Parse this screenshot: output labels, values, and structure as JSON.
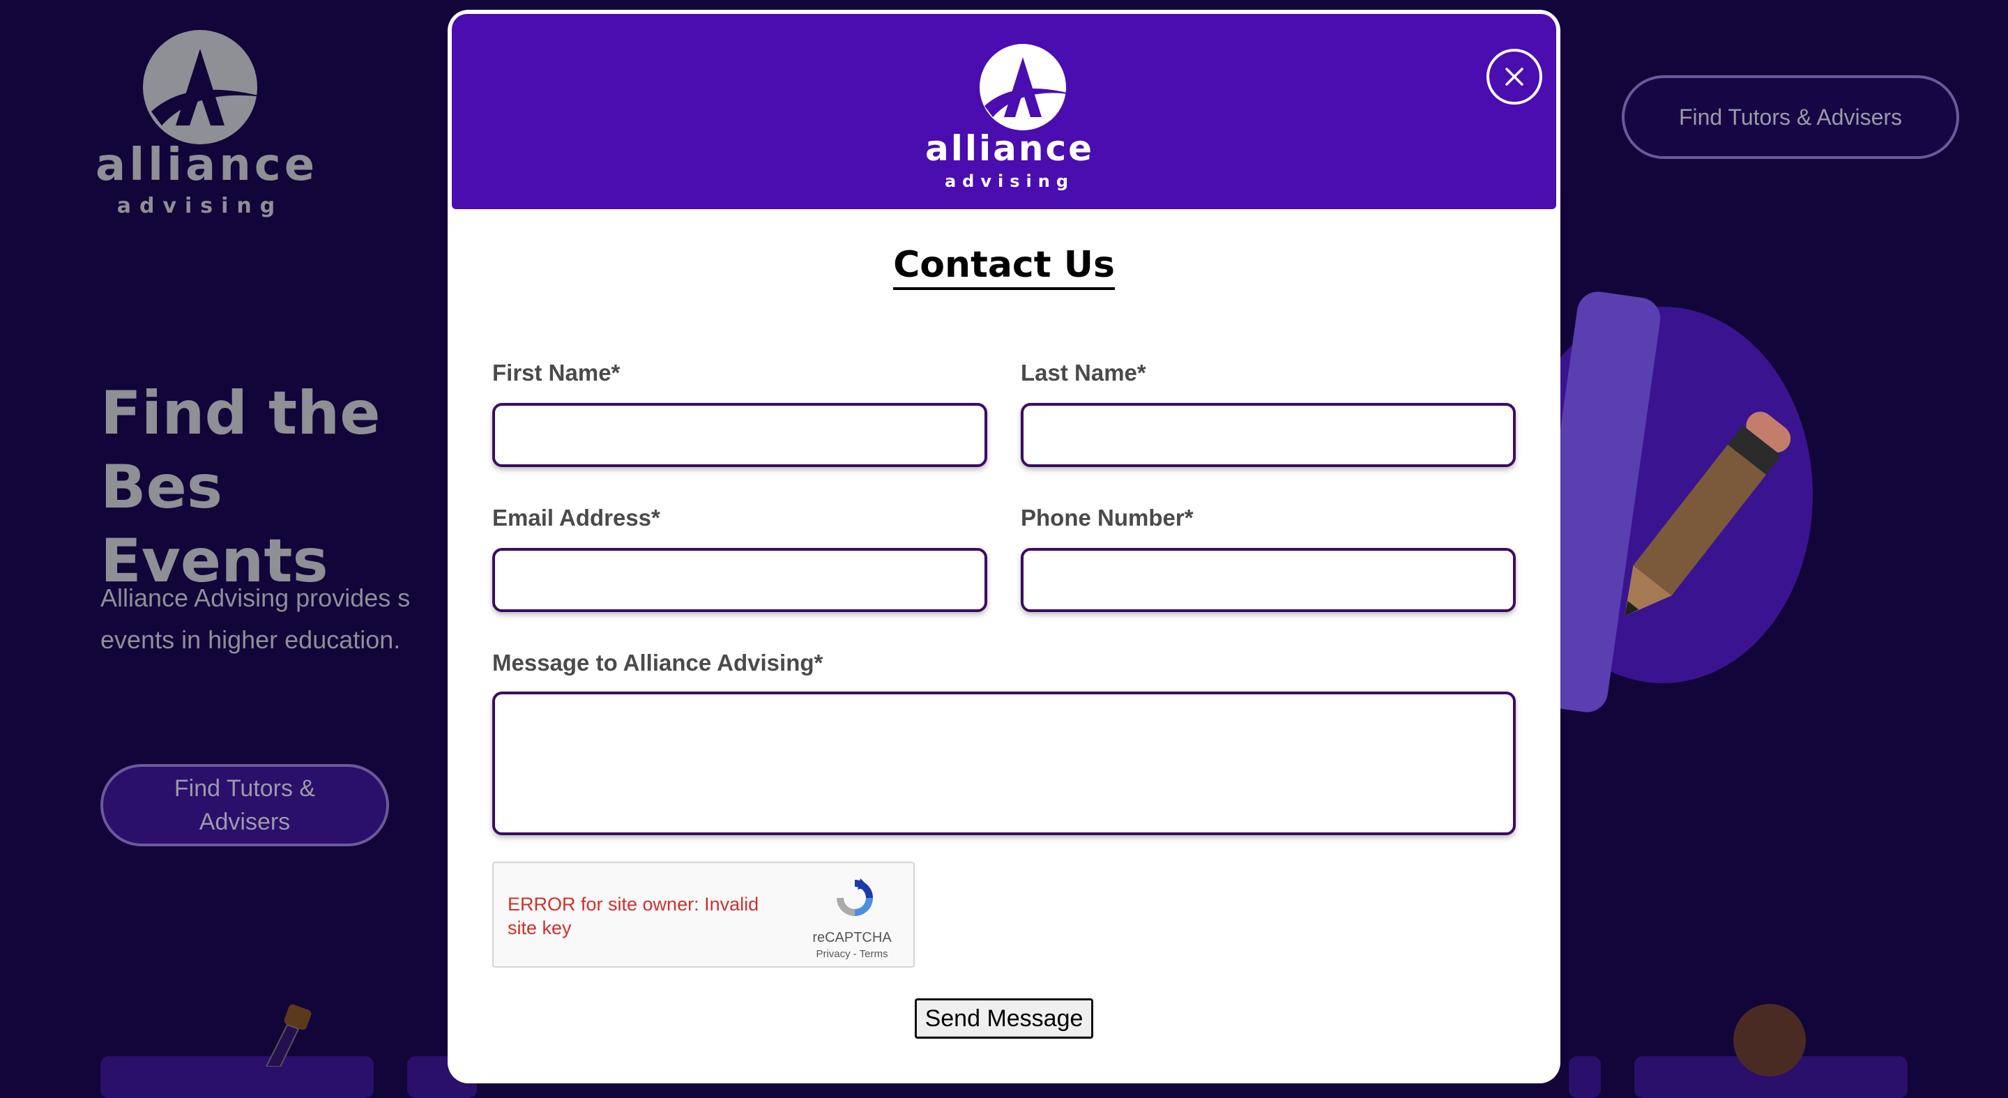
{
  "background": {
    "logo": {
      "word": "alliance",
      "sub": "advising"
    },
    "nav_button_label": "Find Tutors & Advisers",
    "hero_title": "Find the Bes\nEvents",
    "hero_description": "Alliance  Advising  provides  s\nevents in higher education.",
    "hero_button_label": "Find Tutors &\nAdvisers"
  },
  "modal": {
    "logo": {
      "word": "alliance",
      "sub": "advising"
    },
    "title": "Contact Us",
    "fields": {
      "first_name_label": "First Name*",
      "last_name_label": "Last Name*",
      "email_label": "Email Address*",
      "phone_label": "Phone Number*",
      "message_label": "Message to Alliance Advising*"
    },
    "recaptcha": {
      "error": "ERROR for site owner: Invalid site key",
      "name": "reCAPTCHA",
      "links": "Privacy - Terms"
    },
    "send_label": "Send Message"
  },
  "colors": {
    "page_bg": "#11053a",
    "header_bg": "#4a0db0",
    "field_border": "#3c0c63",
    "error_text": "#d0302a"
  }
}
